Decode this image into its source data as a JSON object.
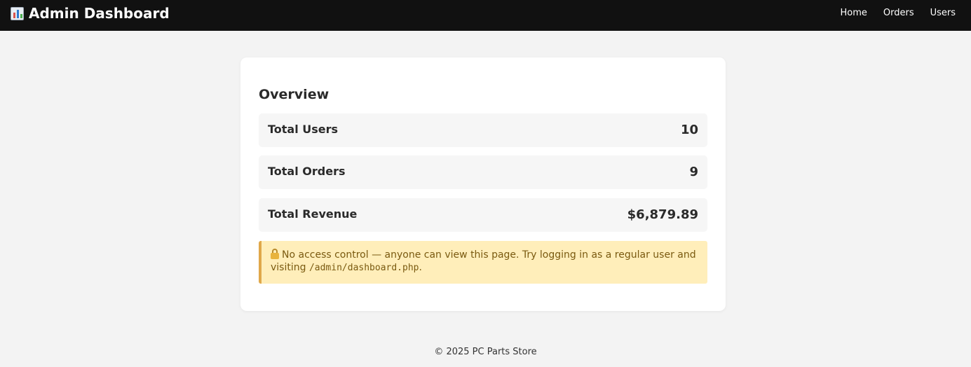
{
  "header": {
    "icon": "bar-chart-icon",
    "title": "Admin Dashboard",
    "nav": [
      {
        "label": "Home"
      },
      {
        "label": "Orders"
      },
      {
        "label": "Users"
      }
    ]
  },
  "overview": {
    "title": "Overview",
    "stats": [
      {
        "label": "Total Users",
        "value": "10"
      },
      {
        "label": "Total Orders",
        "value": "9"
      },
      {
        "label": "Total Revenue",
        "value": "$6,879.89"
      }
    ]
  },
  "warning": {
    "icon": "unlocked-lock-icon",
    "text_before": "No access control — anyone can view this page. Try logging in as a regular user and visiting ",
    "code": "/admin/dashboard.php",
    "text_after": ".",
    "background": "#ffeeba",
    "accent": "#e0a84a"
  },
  "footer": {
    "text": "© 2025 PC Parts Store"
  }
}
